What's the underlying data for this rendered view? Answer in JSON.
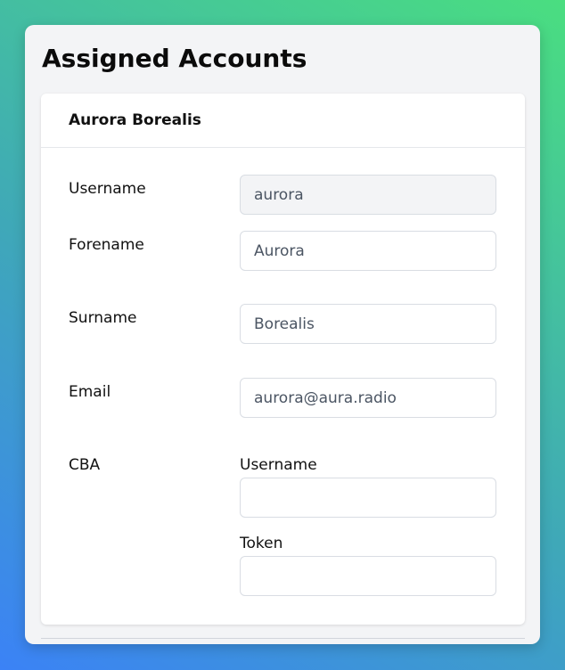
{
  "panel": {
    "title": "Assigned Accounts"
  },
  "account": {
    "name": "Aurora Borealis",
    "fields": {
      "username": {
        "label": "Username",
        "value": "aurora"
      },
      "forename": {
        "label": "Forename",
        "value": "Aurora"
      },
      "surname": {
        "label": "Surname",
        "value": "Borealis"
      },
      "email": {
        "label": "Email",
        "value": "aurora@aura.radio"
      }
    },
    "cba": {
      "label": "CBA",
      "username": {
        "label": "Username",
        "value": ""
      },
      "token": {
        "label": "Token",
        "value": ""
      }
    }
  }
}
